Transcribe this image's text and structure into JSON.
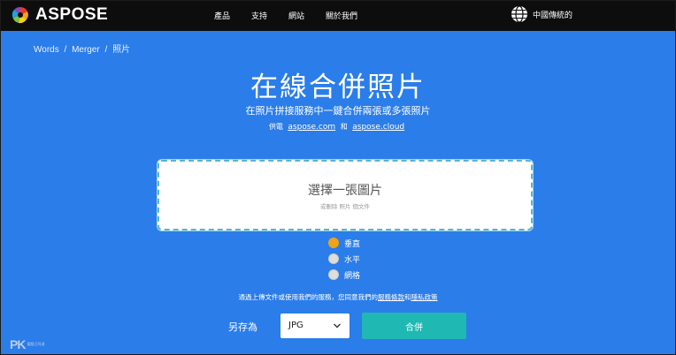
{
  "header": {
    "brand": "ASPOSE",
    "nav": [
      "產品",
      "支持",
      "網站",
      "關於我們"
    ],
    "language": "中國傳統的"
  },
  "breadcrumb": [
    "Words",
    "/",
    "Merger",
    "/",
    "照片"
  ],
  "hero": {
    "title": "在線合併照片",
    "subtitle": "在照片拼接服務中一鍵合併兩張或多張照片",
    "powered_prefix": "供電",
    "link1": "aspose.com",
    "conj": "和",
    "link2": "aspose.cloud"
  },
  "dropzone": {
    "title": "選擇一張圖片",
    "hint": "或刪除 照片 個文件"
  },
  "layout_options": [
    {
      "label": "垂直",
      "selected": true
    },
    {
      "label": "水平",
      "selected": false
    },
    {
      "label": "網格",
      "selected": false
    }
  ],
  "terms": {
    "text": "通過上傳文件或使用我們的服務，您同意我們的",
    "tos": "服務條款",
    "and": "和",
    "privacy": "隱私政策"
  },
  "save": {
    "label": "另存為",
    "format": "JPG",
    "button": "合併"
  },
  "watermark": {
    "text": "PK",
    "small": "電腦王阿達"
  },
  "colors": {
    "background": "#2b7de9",
    "topbar": "#0d0d0d",
    "accent_radio": "#f0a21a",
    "merge_button": "#1fb8b2"
  }
}
